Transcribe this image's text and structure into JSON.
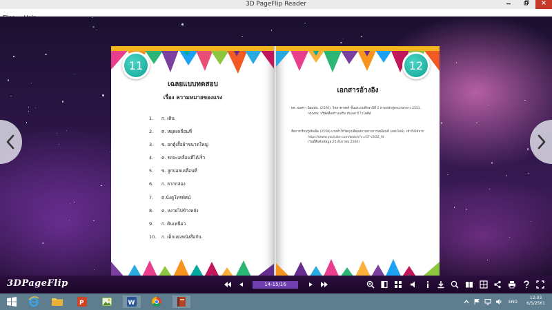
{
  "window": {
    "title": "3D PageFlip Reader"
  },
  "menu": [
    {
      "label": "Files"
    },
    {
      "label": "Help"
    }
  ],
  "left_page": {
    "number": "11",
    "heading": "เฉลยแบบทดสอบ",
    "subheading": "เรื่อง ความหมายของแรง",
    "answers": [
      {
        "num": "1.",
        "text": "ก. เดิน"
      },
      {
        "num": "2.",
        "text": "ค. หยุดเคลื่อนที่"
      },
      {
        "num": "3.",
        "text": "ข. ยกตู้เสื้อผ้าขนาดใหญ่"
      },
      {
        "num": "4.",
        "text": "ค. รถจะเคลื่อนที่ได้เร็ว"
      },
      {
        "num": "5.",
        "text": "ข.  ลูกบอลเคลื่อนที่"
      },
      {
        "num": "6.",
        "text": "ก. ลากกล่อง"
      },
      {
        "num": "7.",
        "text": "ค.นั่งดูโทรทัศน์"
      },
      {
        "num": "8.",
        "text": "ค. หงายไปข้างหลัง"
      },
      {
        "num": "9.",
        "text": "ก. ดินเหนียว"
      },
      {
        "num": "10.",
        "text": "ก. เด็กแย่งหนังสือกัน"
      }
    ]
  },
  "right_page": {
    "number": "12",
    "heading": "เอกสารอ้างอิง",
    "refs": [
      {
        "line1": "ผศ. ผมศรา  นิยมพัน.  (2556).  วิทยาศาสตร์ ชั้นประถมศึกษาปีที่ 2 ตามหลักสูตรแกนกลาง 2551.",
        "line2": "กรุงเทพ: บริษัทสื่อสร้างเสริม ทับเอส บ๊ ไวโคศิล์"
      },
      {
        "line1": "สื่อการเรียนรู้เสียเอ็ด (2558).แรงทำให้วัตถุเปลี่ยนสภาพทางการเคลื่อนที่ (ออนไลน์). เข้าถึงได้จาก",
        "line2": "https://www.youtube.com/watch?v=G7-cSOZ_fd",
        "line3": "(วันที่สืบค้นข้อมูล 25 ธันวาคม 2560)"
      }
    ]
  },
  "toolbar": {
    "brand": "3DPageFlip",
    "page_indicator": "14-15/16"
  },
  "taskbar": {
    "lang": "ENG",
    "time": "12:03",
    "date": "6/5/2561"
  }
}
